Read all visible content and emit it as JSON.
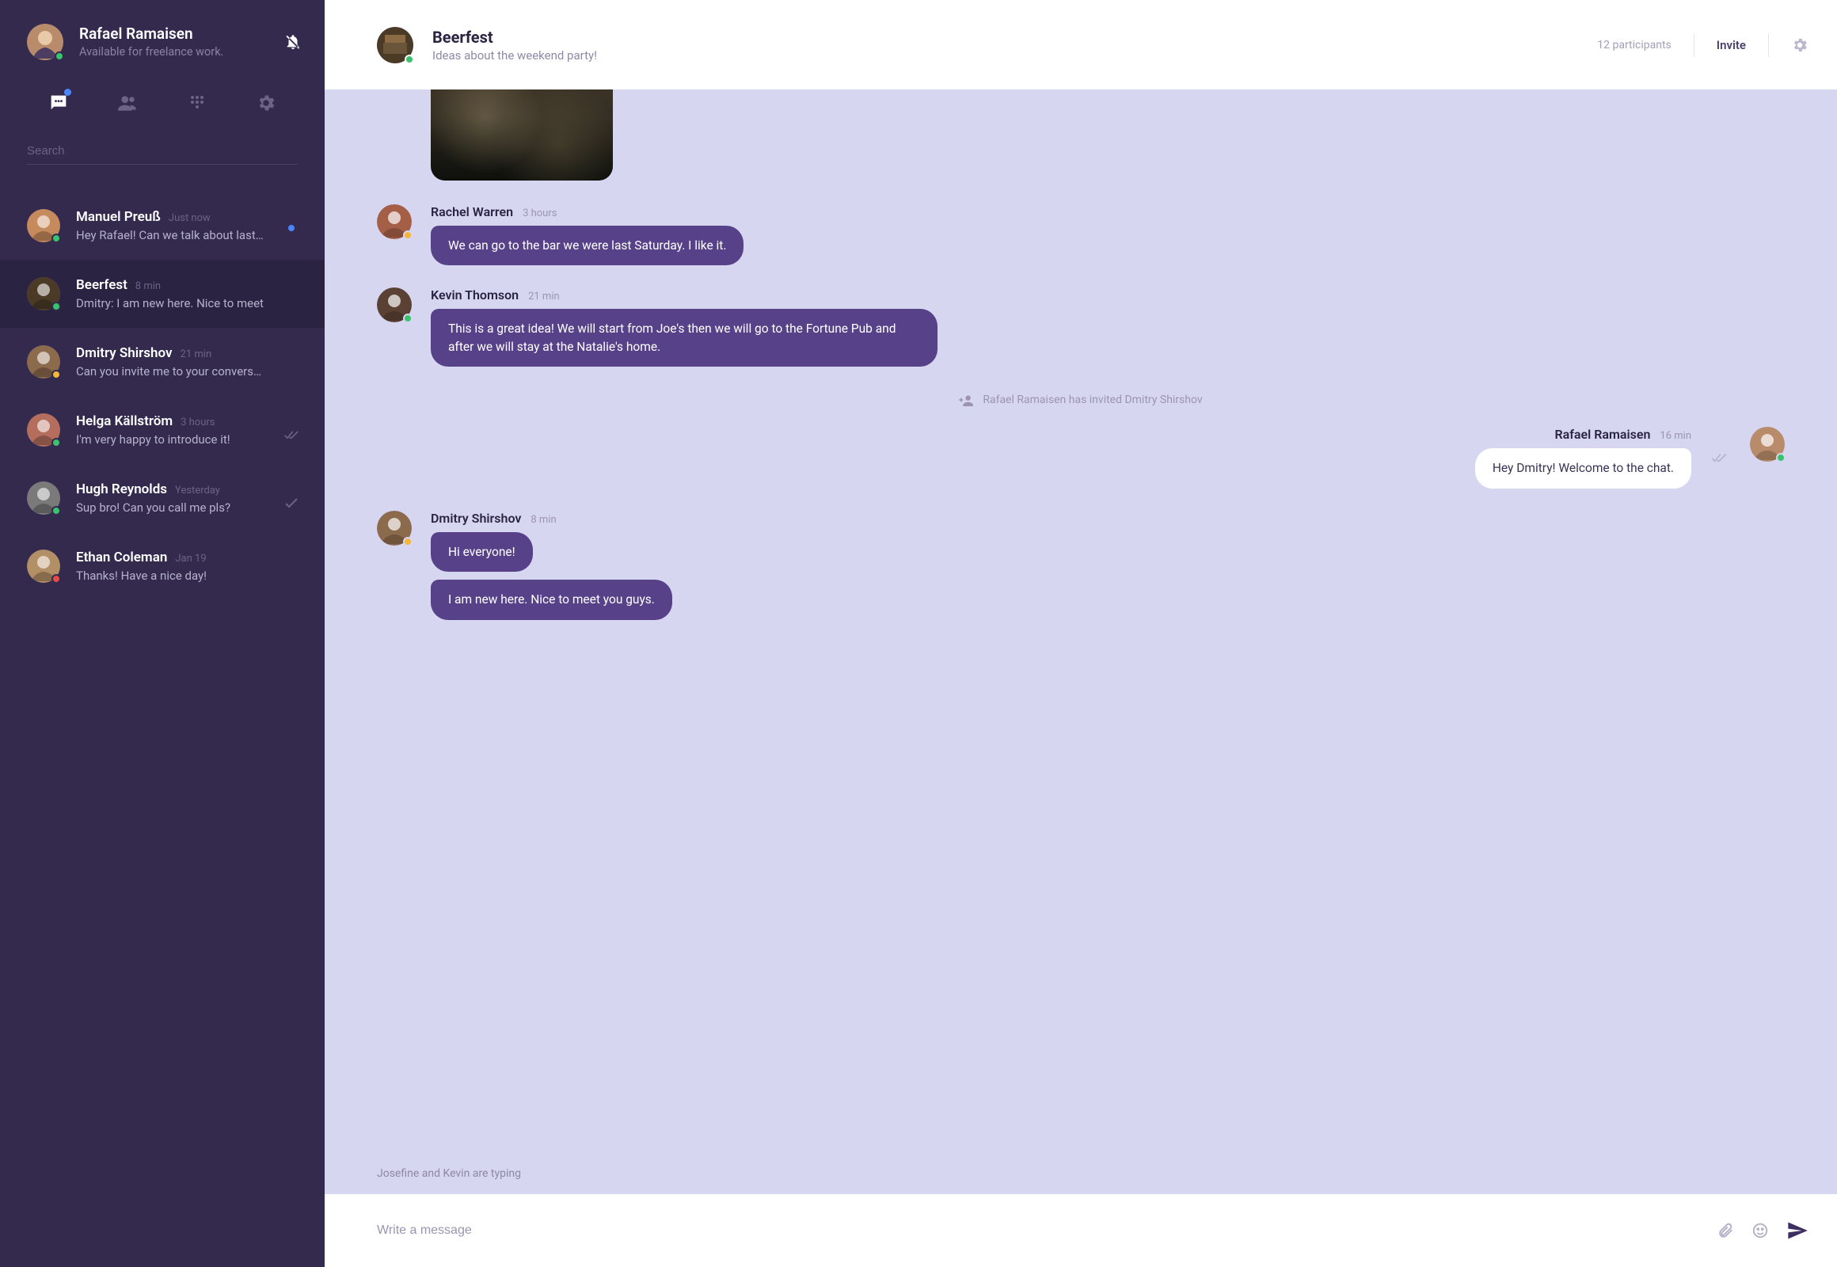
{
  "user": {
    "name": "Rafael Ramaisen",
    "status": "Available for freelance work.",
    "presence": "green"
  },
  "search": {
    "placeholder": "Search"
  },
  "sidebar_tabs": {
    "active": "chats",
    "icons": [
      "chat-bubble-icon",
      "people-icon",
      "dialpad-icon",
      "gear-icon"
    ]
  },
  "conversations": [
    {
      "name": "Manuel Preuß",
      "time": "Just now",
      "preview": "Hey Rafael! Can we talk about last co",
      "presence": "green",
      "indicator": "unread",
      "active": false
    },
    {
      "name": "Beerfest",
      "time": "8 min",
      "preview": "Dmitry: I am new here. Nice to meet",
      "presence": "green",
      "indicator": "none",
      "active": true
    },
    {
      "name": "Dmitry Shirshov",
      "time": "21 min",
      "preview": "Can you invite me to your conversati",
      "presence": "yellow",
      "indicator": "none",
      "active": false
    },
    {
      "name": "Helga Källström",
      "time": "3 hours",
      "preview": "I'm very happy to introduce it!",
      "presence": "green",
      "indicator": "read",
      "active": false
    },
    {
      "name": "Hugh Reynolds",
      "time": "Yesterday",
      "preview": "Sup bro! Can you call me pls?",
      "presence": "green",
      "indicator": "sent",
      "active": false
    },
    {
      "name": "Ethan Coleman",
      "time": "Jan 19",
      "preview": "Thanks! Have a nice day!",
      "presence": "red",
      "indicator": "none",
      "active": false
    }
  ],
  "chat": {
    "title": "Beerfest",
    "subtitle": "Ideas about the weekend party!",
    "participants": "12 participants",
    "invite": "Invite",
    "presence": "green"
  },
  "messages": [
    {
      "kind": "image",
      "alt": "bar-interior-photo"
    },
    {
      "kind": "msg",
      "side": "left",
      "sender": "Rachel Warren",
      "time": "3 hours",
      "presence": "yellow",
      "bubbles": [
        "We can go to the bar we were last Saturday. I like it."
      ]
    },
    {
      "kind": "msg",
      "side": "left",
      "sender": "Kevin Thomson",
      "time": "21 min",
      "presence": "green",
      "bubbles": [
        "This is a great idea! We will start from Joe's then we will go to the Fortune Pub and after we will stay at the Natalie's home."
      ]
    },
    {
      "kind": "system",
      "text": "Rafael Ramaisen has invited Dmitry Shirshov"
    },
    {
      "kind": "msg",
      "side": "right",
      "sender": "Rafael Ramaisen",
      "time": "16 min",
      "presence": "green",
      "read": true,
      "bubbles": [
        "Hey Dmitry! Welcome to the chat."
      ]
    },
    {
      "kind": "msg",
      "side": "left",
      "sender": "Dmitry Shirshov",
      "time": "8 min",
      "presence": "yellow",
      "bubbles": [
        "Hi everyone!",
        "I am new here. Nice to meet you guys."
      ]
    }
  ],
  "typing": "Josefine and Kevin are typing",
  "composer": {
    "placeholder": "Write a message"
  },
  "colors": {
    "purple": "#57428a",
    "sidebar": "#332a4e",
    "bg": "#d7d6f1"
  }
}
